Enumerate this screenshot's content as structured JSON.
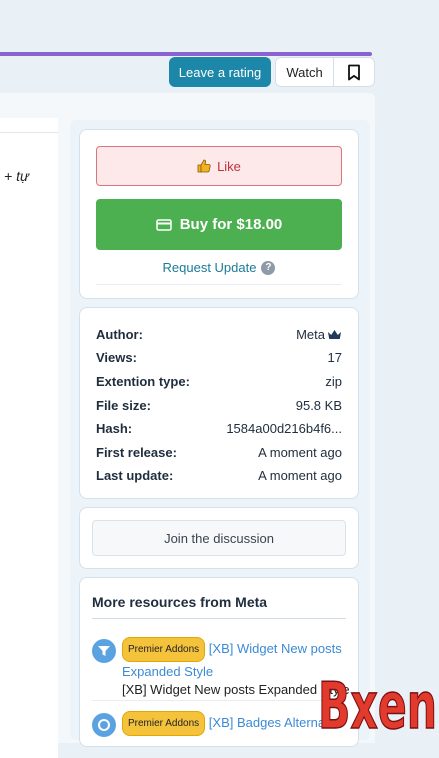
{
  "header": {
    "rating_label": "Leave a rating",
    "watch_label": "Watch",
    "bookmark_icon": "bookmark-icon",
    "accent_color": "#8a63d2"
  },
  "left_snippet": "+ tự",
  "actions": {
    "like_label": "Like",
    "like_icon": "thumbs-up-icon",
    "buy_label": "Buy for $18.00",
    "buy_icon": "credit-card-icon",
    "request_label": "Request Update",
    "help_icon": "question-circle-icon",
    "help_glyph": "?"
  },
  "info": {
    "rows": [
      {
        "key": "Author:",
        "value": "Meta"
      },
      {
        "key": "Views:",
        "value": "17"
      },
      {
        "key": "Extention type:",
        "value": "zip"
      },
      {
        "key": "File size:",
        "value": "95.8 KB"
      },
      {
        "key": "Hash:",
        "value": "1584a00d216b4f6..."
      },
      {
        "key": "First release:",
        "value": "A moment ago"
      },
      {
        "key": "Last update:",
        "value": "A moment ago"
      }
    ],
    "author_icon": "crown-icon"
  },
  "discussion": {
    "label": "Join the discussion"
  },
  "more_resources": {
    "title": "More resources from Meta",
    "items": [
      {
        "badge": "Premier Addons",
        "title": "[XB] Widget New posts Expanded Style",
        "description": "[XB] Widget New posts Expanded Style",
        "icon": "filter-icon"
      },
      {
        "badge": "Premier Addons",
        "title": "[XB] Badges Alterna",
        "description": "",
        "icon": "circle-icon"
      }
    ]
  },
  "watermark": {
    "text": "Bxen"
  },
  "colors": {
    "like": "#c2313a",
    "buy": "#4caf50",
    "link": "#3c8ad6",
    "badge": "#f5c33b"
  }
}
